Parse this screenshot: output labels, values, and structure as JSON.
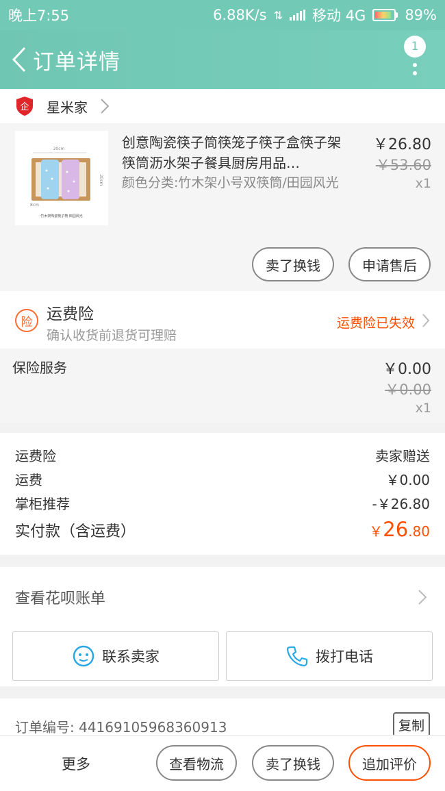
{
  "status_bar": {
    "time": "晚上7:55",
    "speed": "6.88K/s",
    "carrier": "移动 4G",
    "battery": "89%",
    "battery_level": 0.89
  },
  "nav": {
    "title": "订单详情",
    "badge": "1"
  },
  "shop": {
    "name": "星米家"
  },
  "product": {
    "title": "创意陶瓷筷子筒筷笼子筷子盒筷子架筷筒沥水架子餐具厨房用品…",
    "spec": "颜色分类:竹木架小号双筷筒/田园风光",
    "price": "￥26.80",
    "original_price": "￥53.60",
    "quantity": "x1",
    "thumb_dim_width": "20cm",
    "thumb_dim_height": "20cm",
    "thumb_dim_depth": "8cm",
    "thumb_caption": "竹木架陶瓷筷子筒 田园风光",
    "buttons": {
      "sell": "卖了换钱",
      "after_sale": "申请售后"
    }
  },
  "insurance": {
    "icon_char": "险",
    "title": "运费险",
    "subtitle": "确认收货前退货可理赔",
    "status": "运费险已失效"
  },
  "service": {
    "title": "保险服务",
    "price": "￥0.00",
    "original_price": "￥0.00",
    "quantity": "x1"
  },
  "summary": {
    "rows": [
      {
        "label": "运费险",
        "value": "卖家赠送"
      },
      {
        "label": "运费",
        "value": "￥0.00"
      },
      {
        "label": "掌柜推荐",
        "value": "-￥26.80"
      }
    ],
    "total_label": "实付款（含运费）",
    "total_currency": "￥",
    "total_int": "26",
    "total_dec": ".80"
  },
  "huabei": {
    "label": "查看花呗账单"
  },
  "contact": {
    "seller": "联系卖家",
    "call": "拨打电话"
  },
  "order": {
    "number_text": "订单编号: 44169105968360913",
    "copy": "复制"
  },
  "bottom": {
    "more": "更多",
    "logistics": "查看物流",
    "sell": "卖了换钱",
    "review": "追加评价"
  },
  "colors": {
    "nav": "#6fc6b2",
    "accent": "#ff5000",
    "insurance": "#ff6a2e"
  }
}
